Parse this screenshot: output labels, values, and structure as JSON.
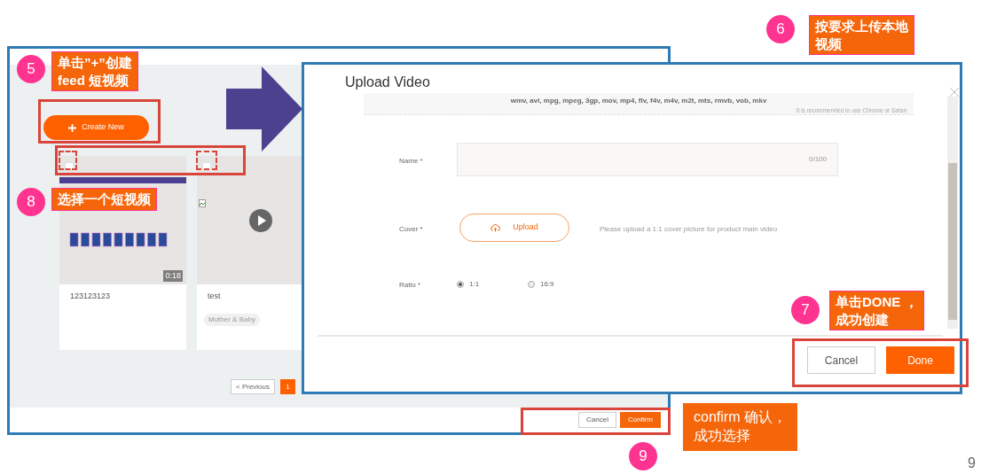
{
  "left_screen": {
    "create_button": "Create New",
    "cards": [
      {
        "kind": "video",
        "title": "123123123",
        "duration": "0:18",
        "checked": false
      },
      {
        "kind": "broken",
        "title": "test",
        "tag": "Mother & Baby",
        "checked": false
      }
    ],
    "pagination": {
      "previous": "< Previous",
      "pages": [
        {
          "label": "1",
          "selected": true
        }
      ]
    },
    "footer_buttons": [
      {
        "label": "Cancel",
        "primary": false
      },
      {
        "label": "Confirm",
        "primary": true
      }
    ]
  },
  "modal": {
    "title": "Upload Video",
    "formats": "wmv, avi, mpg, mpeg, 3gp, mov, mp4, flv, f4v, m4v, m2t, mts, rmvb, vob, mkv",
    "browser_note": "It is recommended to use Chrome or Safari",
    "name_label": "Name *",
    "name_counter": "0/100",
    "cover_label": "Cover *",
    "upload_button": "Upload",
    "cover_hint": "Please upload a 1:1 cover picture for product main video",
    "ratio_label": "Ratio *",
    "ratio_options": [
      {
        "label": "1:1",
        "selected": true
      },
      {
        "label": "16:9",
        "selected": false
      }
    ],
    "buttons": [
      {
        "label": "Cancel",
        "primary": false
      },
      {
        "label": "Done",
        "primary": true
      }
    ]
  },
  "annotations": [
    {
      "number": "5",
      "lines": [
        "单击”+”创建",
        "feed 短视频"
      ]
    },
    {
      "number": "8",
      "lines": [
        "选择一个短视频"
      ]
    },
    {
      "number": "6",
      "lines": [
        "按要求上传本地",
        "视频"
      ]
    },
    {
      "number": "7",
      "lines": [
        "单击DONE ，",
        "成功创建"
      ]
    },
    {
      "number": "9",
      "lines": [
        "confirm 确认，",
        "成功选择"
      ]
    }
  ],
  "page_number": "9"
}
